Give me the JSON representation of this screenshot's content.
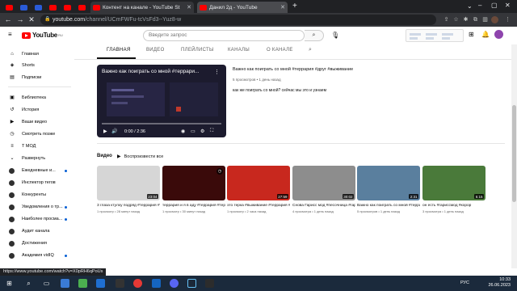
{
  "browser": {
    "tabs": [
      {
        "label": ""
      },
      {
        "label": ""
      },
      {
        "label": ""
      },
      {
        "label": ""
      },
      {
        "label": "Контент на канале - YouTube St"
      },
      {
        "label": "Данил 2д - YouTube"
      }
    ],
    "url_host": "youtube.com",
    "url_path": "/channel/UCmFWFu-tcVsFd3--Yuz8-w",
    "status_url": "https://www.youtube.com/watch?v=X0pRH6qPoUs"
  },
  "header": {
    "logo_text": "YouTube",
    "logo_region": "RU",
    "search_placeholder": "Введите запрос"
  },
  "channel_tabs": [
    "ГЛАВНАЯ",
    "ВИДЕО",
    "ПЛЕЙЛИСТЫ",
    "КАНАЛЫ",
    "О КАНАЛЕ"
  ],
  "sidebar": {
    "main": [
      {
        "label": "Главная",
        "icon": "home-icon"
      },
      {
        "label": "Shorts",
        "icon": "shorts-icon"
      },
      {
        "label": "Подписки",
        "icon": "subscriptions-icon"
      }
    ],
    "library": [
      {
        "label": "Библиотека",
        "icon": "library-icon"
      },
      {
        "label": "История",
        "icon": "history-icon"
      },
      {
        "label": "Ваши видео",
        "icon": "your-videos-icon"
      },
      {
        "label": "Смотреть позже",
        "icon": "watch-later-icon"
      },
      {
        "label": "Т МОД",
        "icon": "playlist-icon"
      },
      {
        "label": "Развернуть",
        "icon": "expand-icon"
      }
    ],
    "subscriptions": [
      {
        "label": "Ежедневные и...",
        "dot": true
      },
      {
        "label": "Инспектор тегов",
        "dot": false
      },
      {
        "label": "Конкуренты",
        "dot": false
      },
      {
        "label": "Уведомления о тр...",
        "dot": true
      },
      {
        "label": "Наиболее просма...",
        "dot": true
      },
      {
        "label": "Аудит канала",
        "dot": false
      },
      {
        "label": "Достижения",
        "dot": false
      },
      {
        "label": "Академия vidIQ",
        "dot": true
      }
    ]
  },
  "featured": {
    "overlay_title": "Важно как поиграть со мной #террари...",
    "title": "Важно как поиграть со мной #террария #друг #выживание",
    "meta": "5 просмотров • 1 день назад",
    "description": "как же поиграть со мной? сейчас мы это и узнаем",
    "time": "0:00 / 2:36"
  },
  "videos": {
    "label": "Видео",
    "play_all": "Воспроизвести все",
    "items": [
      {
        "title": "3 глаза ктулху подряд #террария #терраи...",
        "meta": "1 просмотр • 28 минут назад",
        "duration": "23:04",
        "bg": "#d6d6d6"
      },
      {
        "title": "террария и я в аду #террария #террари...",
        "meta": "1 просмотр • 30 минут назад",
        "duration": "",
        "bg": "#3a0a0a"
      },
      {
        "title": "это терка #выживание #террария #ад",
        "meta": "1 просмотр • 2 часа назад",
        "duration": "27:59",
        "bg": "#c8281e"
      },
      {
        "title": "Снова Гарисс мод #песочница #гариссмод...",
        "meta": "4 просмотра • 1 день назад",
        "duration": "30:02",
        "bg": "#8d8d8d"
      },
      {
        "title": "Важно как поиграть со мной #террария #др...",
        "meta": "5 просмотров • 1 день назад",
        "duration": "2:31",
        "bg": "#5a7f9e"
      },
      {
        "title": "он есть #гариссмод #корор",
        "meta": "3 просмотра • 1 день назад",
        "duration": "5:15",
        "bg": "#4a7a3a"
      }
    ]
  },
  "taskbar": {
    "lang": "РУС",
    "time": "10:33",
    "date": "26.06.2023"
  }
}
